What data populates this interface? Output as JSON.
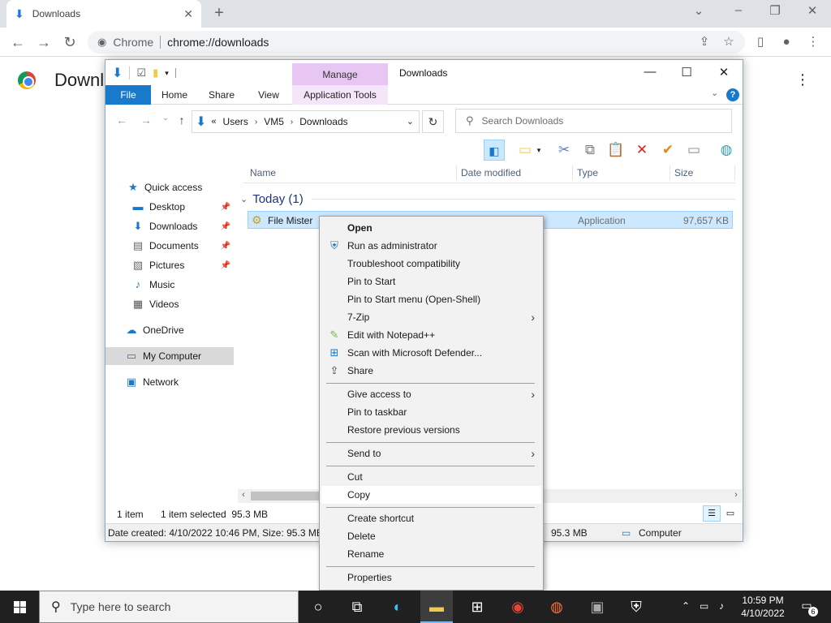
{
  "chrome": {
    "tab_title": "Downloads",
    "site_chip": "Chrome",
    "url": "chrome://downloads",
    "page_heading": "Downl"
  },
  "explorer": {
    "window_title": "Downloads",
    "manage_label": "Manage",
    "ribbon_tabs": {
      "file": "File",
      "home": "Home",
      "share": "Share",
      "view": "View",
      "app_tools": "Application Tools"
    },
    "breadcrumb": [
      "Users",
      "VM5",
      "Downloads"
    ],
    "breadcrumb_prefix": "«",
    "search_placeholder": "Search Downloads",
    "columns": {
      "name": "Name",
      "date": "Date modified",
      "type": "Type",
      "size": "Size"
    },
    "nav": {
      "quick_access": "Quick access",
      "desktop": "Desktop",
      "downloads": "Downloads",
      "documents": "Documents",
      "pictures": "Pictures",
      "music": "Music",
      "videos": "Videos",
      "onedrive": "OneDrive",
      "my_computer": "My Computer",
      "network": "Network"
    },
    "group_header": "Today (1)",
    "file": {
      "name": "File Mister",
      "type": "Application",
      "size": "97,657 KB"
    },
    "status": {
      "items": "1 item",
      "selected": "1 item selected  95.3 MB"
    },
    "details": {
      "created": "Date created: 4/10/2022 10:46 PM, Size: 95.3 MB",
      "size": "95.3 MB",
      "location": "Computer"
    }
  },
  "context_menu": {
    "open": "Open",
    "run_admin": "Run as administrator",
    "troubleshoot": "Troubleshoot compatibility",
    "pin_start": "Pin to Start",
    "pin_start_openshell": "Pin to Start menu (Open-Shell)",
    "seven_zip": "7-Zip",
    "edit_notepad": "Edit with Notepad++",
    "scan_defender": "Scan with Microsoft Defender...",
    "share": "Share",
    "give_access": "Give access to",
    "pin_taskbar": "Pin to taskbar",
    "restore_versions": "Restore previous versions",
    "send_to": "Send to",
    "cut": "Cut",
    "copy": "Copy",
    "create_shortcut": "Create shortcut",
    "delete": "Delete",
    "rename": "Rename",
    "properties": "Properties"
  },
  "taskbar": {
    "search_placeholder": "Type here to search",
    "time": "10:59 PM",
    "date": "4/10/2022",
    "notification_count": "6"
  },
  "colors": {
    "accent_blue": "#1979ca",
    "manage_purple": "#e8c6f3",
    "selection": "#cce8ff",
    "taskbar": "#202020"
  }
}
